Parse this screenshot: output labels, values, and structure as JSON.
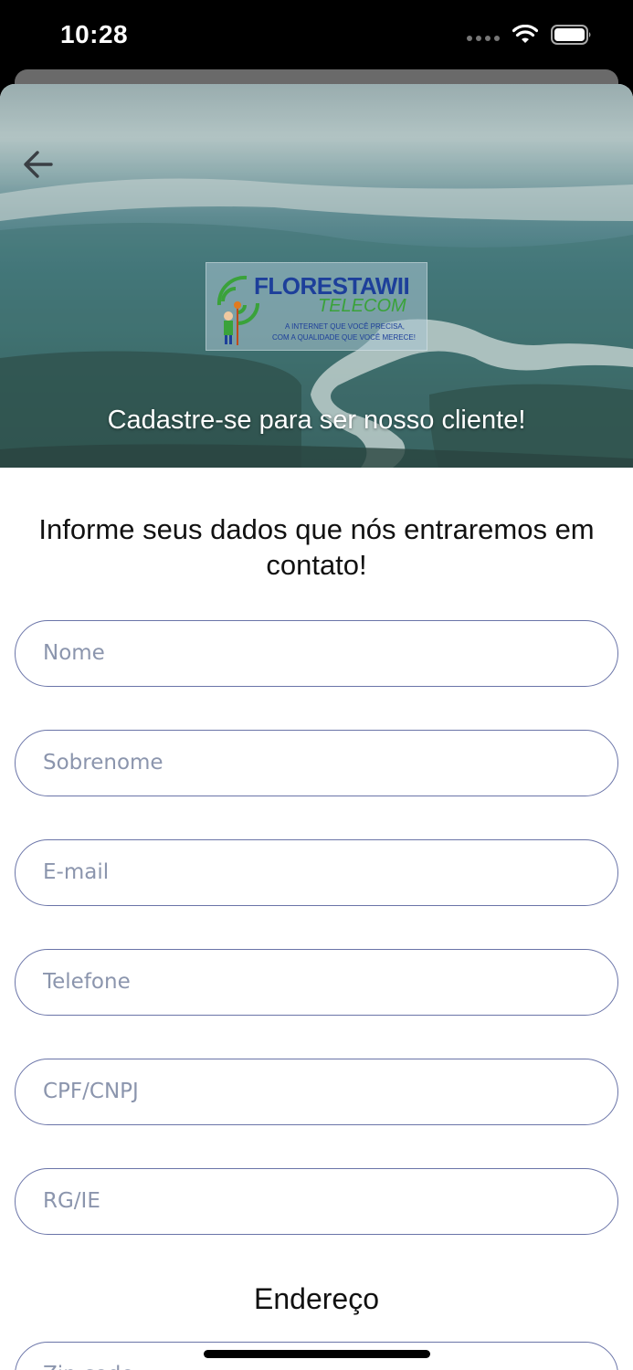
{
  "status_bar": {
    "time": "10:28"
  },
  "hero": {
    "caption": "Cadastre-se para ser nosso cliente!",
    "logo": {
      "name": "FLORESTAWII",
      "subname": "TELECOM",
      "tagline_1": "A INTERNET QUE VOCÊ PRECISA,",
      "tagline_2": "COM A QUALIDADE QUE VOCÊ MERECE!"
    }
  },
  "form": {
    "heading": "Informe seus dados que nós entraremos em contato!",
    "fields": [
      {
        "placeholder": "Nome",
        "value": ""
      },
      {
        "placeholder": "Sobrenome",
        "value": ""
      },
      {
        "placeholder": "E-mail",
        "value": ""
      },
      {
        "placeholder": "Telefone",
        "value": ""
      },
      {
        "placeholder": "CPF/CNPJ",
        "value": ""
      },
      {
        "placeholder": "RG/IE",
        "value": ""
      }
    ],
    "address_section_title": "Endereço",
    "address_fields": [
      {
        "placeholder": "Zip code",
        "value": ""
      }
    ]
  },
  "colors": {
    "field_border": "#6a74a8",
    "placeholder": "#8b95ad",
    "logo_blue": "#1d3f9a",
    "logo_green": "#3aa23a"
  }
}
